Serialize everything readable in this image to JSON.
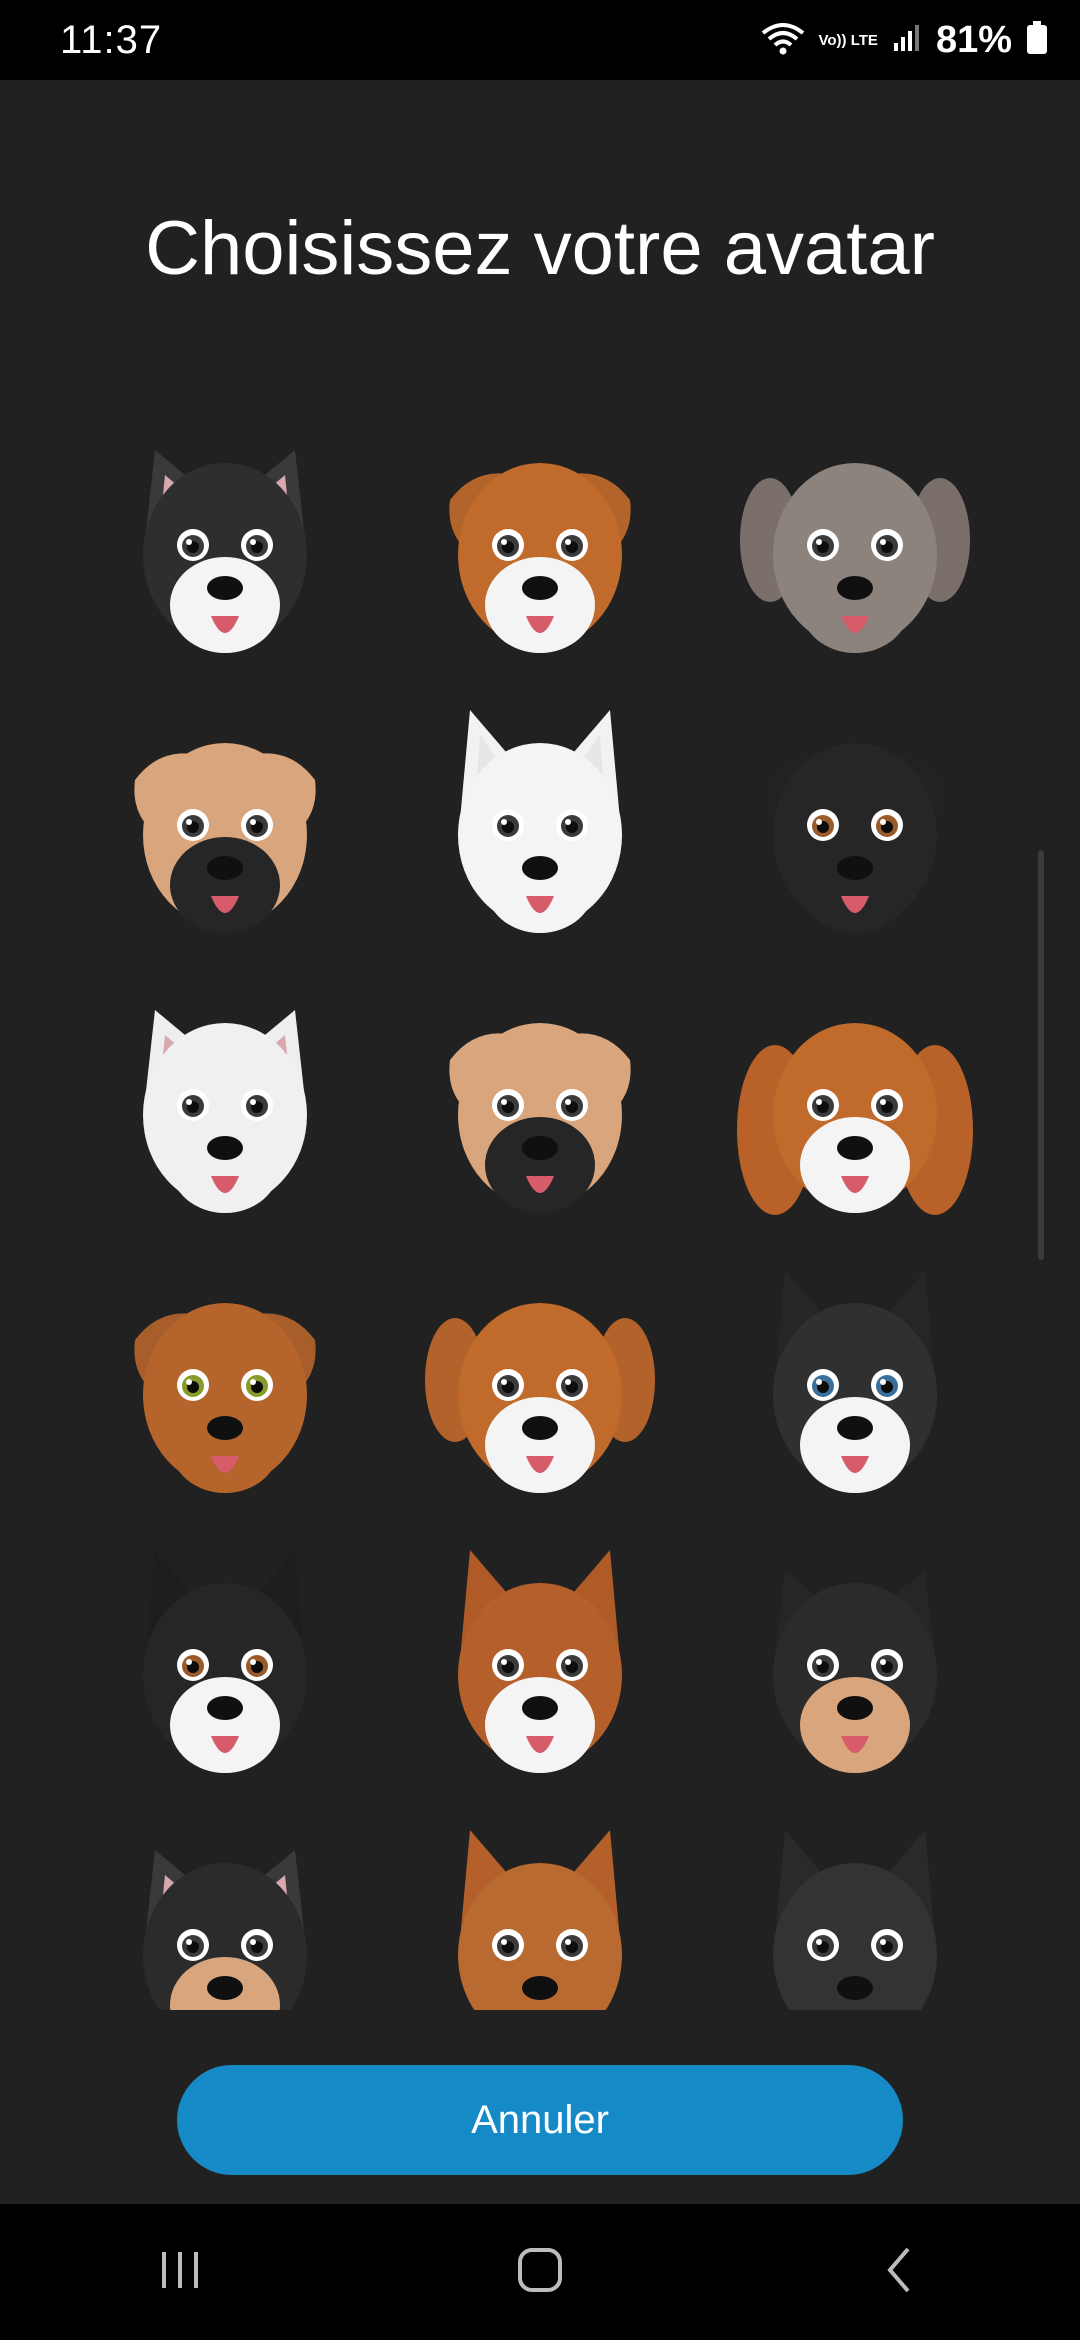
{
  "status_bar": {
    "time": "11:37",
    "network_badge": "Vo)) LTE",
    "battery": "81%"
  },
  "screen": {
    "title": "Choisissez votre avatar",
    "cancel_label": "Annuler"
  },
  "avatars": [
    {
      "name": "avatar-french-bulldog-black",
      "ear": "#3a3a3a",
      "face": "#2e2e2e",
      "muzzle": "#f4f4f4",
      "inner": "#d9a8ad",
      "eye": "#3b3b3b",
      "type": "erect"
    },
    {
      "name": "avatar-boxer-fawn",
      "ear": "#b3642a",
      "face": "#c06a2c",
      "muzzle": "#f4f4f4",
      "inner": "#b3642a",
      "eye": "#3b3b3b",
      "type": "floppy"
    },
    {
      "name": "avatar-weimaraner-grey",
      "ear": "#7a6f6b",
      "face": "#8d837d",
      "muzzle": "#8d837d",
      "inner": "#7a6f6b",
      "eye": "#3b3b3b",
      "type": "long"
    },
    {
      "name": "avatar-boxer-black-mask",
      "ear": "#d9a57c",
      "face": "#d9a57c",
      "muzzle": "#262626",
      "inner": "#d9a57c",
      "eye": "#3b3b3b",
      "type": "floppy"
    },
    {
      "name": "avatar-bull-terrier-white",
      "ear": "#f2f2f2",
      "face": "#f4f4f4",
      "muzzle": "#f4f4f4",
      "inner": "#e6e6e6",
      "eye": "#3b3b3b",
      "type": "tall"
    },
    {
      "name": "avatar-black-labrador",
      "ear": "#222222",
      "face": "#262626",
      "muzzle": "#262626",
      "inner": "#222222",
      "eye": "#9a5a2a",
      "type": "floppy"
    },
    {
      "name": "avatar-westie-white",
      "ear": "#eeeeee",
      "face": "#f0f0f0",
      "muzzle": "#f0f0f0",
      "inner": "#d9a8ad",
      "eye": "#3b3b3b",
      "type": "erect"
    },
    {
      "name": "avatar-boxer-black-mask-2",
      "ear": "#d9a57c",
      "face": "#d9a57c",
      "muzzle": "#262626",
      "inner": "#d9a57c",
      "eye": "#3b3b3b",
      "type": "floppy"
    },
    {
      "name": "avatar-cavalier-king-charles",
      "ear": "#b8622a",
      "face": "#c06a2c",
      "muzzle": "#f4f4f4",
      "inner": "#b8622a",
      "eye": "#3b3b3b",
      "type": "curly"
    },
    {
      "name": "avatar-brown-labrador",
      "ear": "#a85e2a",
      "face": "#b5652c",
      "muzzle": "#b5652c",
      "inner": "#a85e2a",
      "eye": "#8a9a2a",
      "type": "floppy"
    },
    {
      "name": "avatar-beagle-brown",
      "ear": "#b3622b",
      "face": "#c06a2c",
      "muzzle": "#f4f4f4",
      "inner": "#b3622b",
      "eye": "#3b3b3b",
      "type": "long"
    },
    {
      "name": "avatar-husky-blue-eyes",
      "ear": "#262626",
      "face": "#303030",
      "muzzle": "#f4f4f4",
      "inner": "#262626",
      "eye": "#3a6f9a",
      "type": "tall"
    },
    {
      "name": "avatar-malamute-black",
      "ear": "#1e1e1e",
      "face": "#262626",
      "muzzle": "#f4f4f4",
      "inner": "#1e1e1e",
      "eye": "#9a5a2a",
      "type": "tall"
    },
    {
      "name": "avatar-shiba-red",
      "ear": "#b05a28",
      "face": "#b5602a",
      "muzzle": "#f4f4f4",
      "inner": "#b05a28",
      "eye": "#3b3b3b",
      "type": "tall"
    },
    {
      "name": "avatar-yorkshire-terrier",
      "ear": "#262626",
      "face": "#2b2b2b",
      "muzzle": "#d9a57c",
      "inner": "#262626",
      "eye": "#3b3b3b",
      "type": "erect"
    },
    {
      "name": "avatar-chihuahua-black-tan",
      "ear": "#3a3a3a",
      "face": "#2b2b2b",
      "muzzle": "#d9a57c",
      "inner": "#d9a8ad",
      "eye": "#3b3b3b",
      "type": "erect"
    },
    {
      "name": "avatar-german-shepherd-red",
      "ear": "#b5602a",
      "face": "#b86a30",
      "muzzle": "#b86a30",
      "inner": "#b5602a",
      "eye": "#3b3b3b",
      "type": "tall"
    },
    {
      "name": "avatar-schnauzer-black",
      "ear": "#2a2a2a",
      "face": "#333333",
      "muzzle": "#333333",
      "inner": "#2a2a2a",
      "eye": "#3b3b3b",
      "type": "tall"
    }
  ],
  "icons": {
    "wifi": "wifi-icon",
    "signal": "signal-icon",
    "battery": "battery-icon",
    "recents": "recents-icon",
    "home": "home-icon",
    "back": "back-icon"
  }
}
